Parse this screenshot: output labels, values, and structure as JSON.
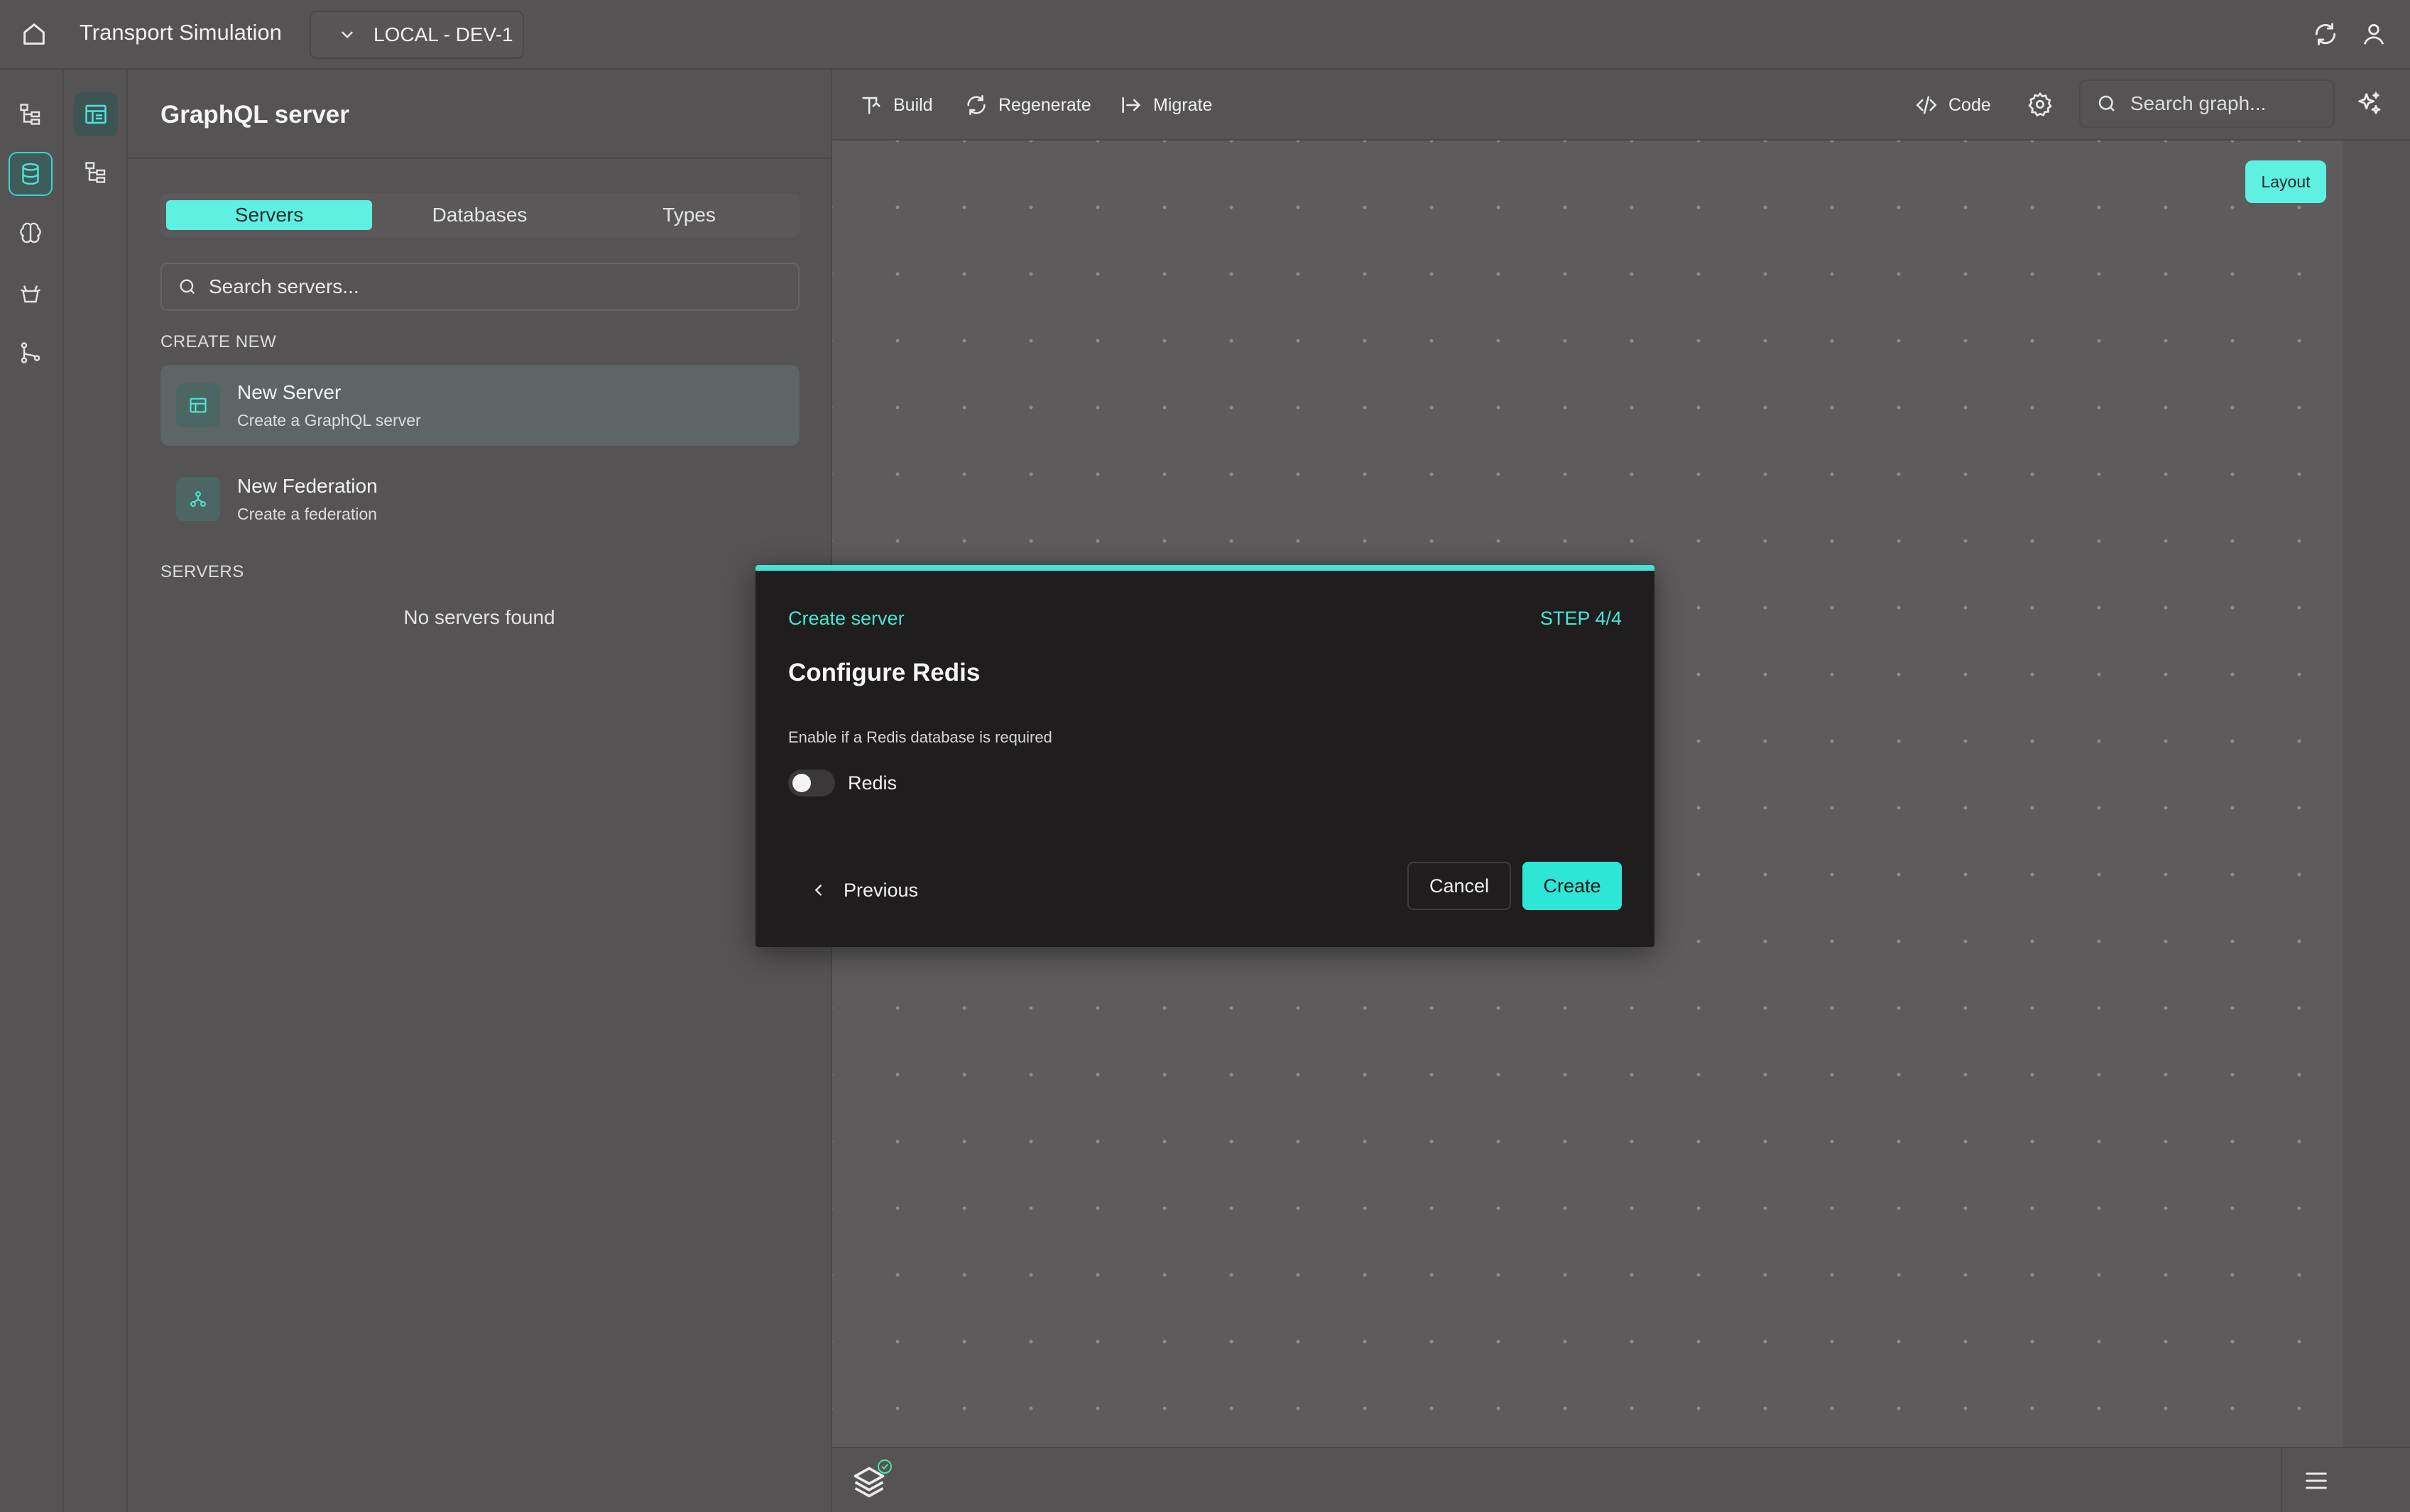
{
  "colors": {
    "accent": "#2ee6d6",
    "background": "#555354",
    "modal_bg": "#1f1d1e"
  },
  "topbar": {
    "title": "Transport Simulation",
    "environment": "LOCAL - DEV-1",
    "icons": [
      "home-icon",
      "chevron-down-icon",
      "refresh-icon",
      "user-icon"
    ]
  },
  "rail": {
    "icons": [
      "tree-icon",
      "database-icon",
      "brain-icon",
      "bot-icon",
      "git-branch-icon"
    ],
    "active": "database-icon"
  },
  "rail2": {
    "icons": [
      "dashboard-icon",
      "hierarchy-icon"
    ],
    "active": "dashboard-icon"
  },
  "panel": {
    "title": "GraphQL server",
    "tabs": [
      {
        "label": "Servers",
        "active": true
      },
      {
        "label": "Databases",
        "active": false
      },
      {
        "label": "Types",
        "active": false
      }
    ],
    "search_placeholder": "Search servers...",
    "create_label": "CREATE NEW",
    "create_items": [
      {
        "name": "New Server",
        "desc": "Create a GraphQL server",
        "icon": "server-icon"
      },
      {
        "name": "New Federation",
        "desc": "Create a federation",
        "icon": "federation-icon"
      }
    ],
    "servers_label": "SERVERS",
    "empty_text": "No servers found"
  },
  "toolbar": {
    "build": "Build",
    "regenerate": "Regenerate",
    "migrate": "Migrate",
    "code": "Code",
    "search_placeholder": "Search graph..."
  },
  "canvas": {
    "layout_label": "Layout"
  },
  "modal": {
    "kicker": "Create server",
    "step": "STEP 4/4",
    "heading": "Configure Redis",
    "help": "Enable if a Redis database is required",
    "toggle_label": "Redis",
    "toggle_on": false,
    "previous": "Previous",
    "cancel": "Cancel",
    "create": "Create"
  }
}
